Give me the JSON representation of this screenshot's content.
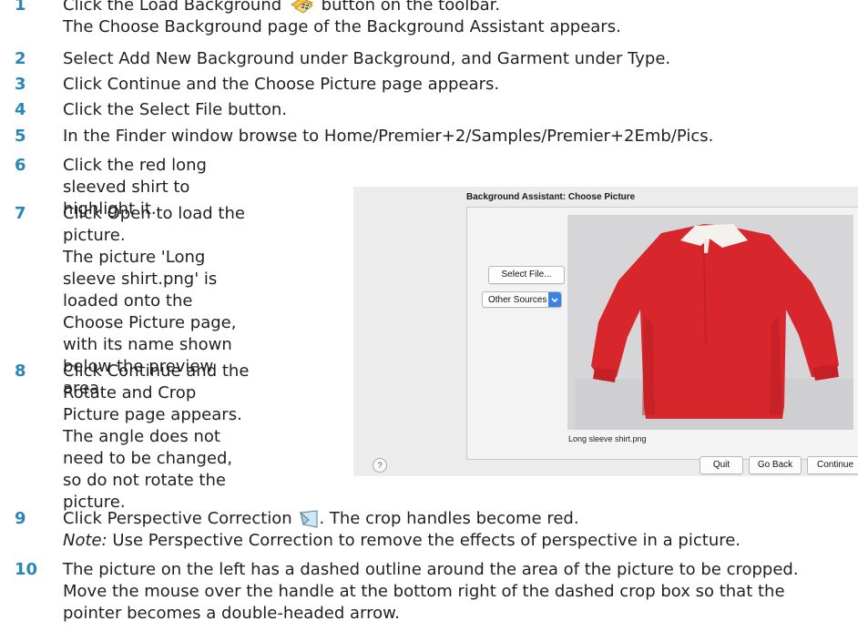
{
  "steps": [
    {
      "num": "1",
      "lines": [
        "Click the Load Background",
        "button on the toolbar.",
        "The Choose Background page of the Background Assistant appears."
      ]
    },
    {
      "num": "2",
      "text": "Select Add New Background under Background, and Garment under Type."
    },
    {
      "num": "3",
      "text": "Click Continue and the Choose Picture page appears."
    },
    {
      "num": "4",
      "text": "Click the Select File button."
    },
    {
      "num": "5",
      "text": "In the Finder window browse to Home/Premier+2/Samples/Premier+2Emb/Pics."
    },
    {
      "num": "6",
      "text": "Click the red long sleeved shirt to highlight it."
    },
    {
      "num": "7",
      "text1": "Click Open to load the picture.",
      "text2": "The picture 'Long sleeve shirt.png' is loaded onto the Choose Picture page, with its name shown below the preview area."
    },
    {
      "num": "8",
      "text": "Click Continue and the Rotate and Crop Picture page appears. The angle does not need to be changed, so do not rotate the picture."
    },
    {
      "num": "9",
      "lines": [
        "Click Perspective Correction",
        ". The crop handles become red."
      ],
      "note_label": "Note:",
      "note_text": " Use Perspective Correction to remove the effects of perspective in a picture."
    },
    {
      "num": "10",
      "lines": [
        "The picture on the left has a dashed outline around the area of the picture to be cropped.",
        "Move the mouse over the handle at the bottom right of the dashed crop box so that the",
        "pointer becomes a double-headed arrow."
      ]
    }
  ],
  "icons": {
    "load_background": "load-background-icon",
    "perspective_correction": "perspective-correction-icon"
  },
  "dialog": {
    "title": "Background Assistant: Choose Picture",
    "select_file": "Select File...",
    "other_sources": "Other Sources",
    "file_name": "Long sleeve shirt.png",
    "help": "?",
    "quit": "Quit",
    "go_back": "Go Back",
    "continue": "Continue"
  },
  "colors": {
    "step_number": "#2b86b8",
    "shirt": "#d8262d",
    "dropdown_accent": "#3b82e6"
  }
}
